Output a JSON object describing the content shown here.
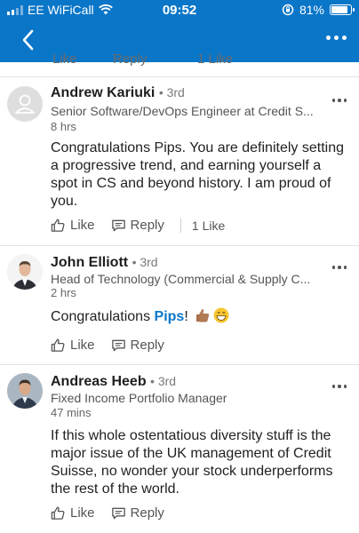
{
  "status_bar": {
    "carrier": "EE WiFiCall",
    "time": "09:52",
    "battery": "81%",
    "battery_level": 0.81,
    "signal_icon": "signal-bars-icon",
    "wifi_icon": "wifi-icon"
  },
  "nav": {
    "back_icon": "chevron-left-icon",
    "more_icon": "more-horizontal-icon"
  },
  "partial_row": {
    "like": "Like",
    "reply": "Reply",
    "likes_count": "1 Like"
  },
  "comments": [
    {
      "name": "Andrew Kariuki",
      "degree": "• 3rd",
      "headline": "Senior Software/DevOps Engineer at Credit S...",
      "time": "8 hrs",
      "body": "Congratulations Pips. You are definitely setting a progressive trend, and earning yourself a spot in CS and beyond history. I am proud of you.",
      "like": "Like",
      "reply": "Reply",
      "likes_count": "1 Like"
    },
    {
      "name": "John Elliott",
      "degree": "• 3rd",
      "headline": "Head of Technology (Commercial & Supply C...",
      "time": "2 hrs",
      "body_prefix": "Congratulations ",
      "mention": "Pips",
      "body_suffix": "!",
      "like": "Like",
      "reply": "Reply"
    },
    {
      "name": "Andreas Heeb",
      "degree": "• 3rd",
      "headline": "Fixed Income Portfolio Manager",
      "time": "47 mins",
      "body": "If this whole ostentatious diversity stuff is the major issue of the UK management of Credit Suisse, no wonder your stock underperforms the rest of the world.",
      "like": "Like",
      "reply": "Reply"
    }
  ],
  "colors": {
    "brand_blue": "#0a76c8",
    "mention": "#0a76c8"
  }
}
